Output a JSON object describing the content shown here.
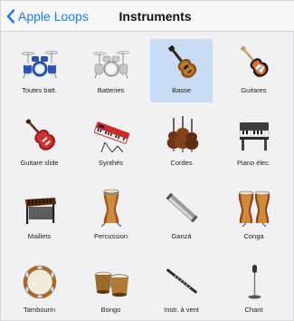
{
  "navbar": {
    "back_label": "Apple Loops",
    "title": "Instruments"
  },
  "instruments": [
    {
      "label": "Toutes batt.",
      "icon": "drum-kit-blue-icon",
      "selected": false
    },
    {
      "label": "Batteries",
      "icon": "drum-kit-silver-icon",
      "selected": false
    },
    {
      "label": "Basse",
      "icon": "bass-guitar-icon",
      "selected": true
    },
    {
      "label": "Guitares",
      "icon": "electric-guitar-icon",
      "selected": false
    },
    {
      "label": "Guitare slide",
      "icon": "red-guitar-icon",
      "selected": false
    },
    {
      "label": "Synthés",
      "icon": "synth-keyboard-icon",
      "selected": false
    },
    {
      "label": "Cordes",
      "icon": "cello-icon",
      "selected": false
    },
    {
      "label": "Piano élec.",
      "icon": "electric-piano-icon",
      "selected": false
    },
    {
      "label": "Maillets",
      "icon": "marimba-icon",
      "selected": false
    },
    {
      "label": "Percussion",
      "icon": "conga-icon",
      "selected": false
    },
    {
      "label": "Ganzá",
      "icon": "shaker-icon",
      "selected": false
    },
    {
      "label": "Conga",
      "icon": "conga-pair-icon",
      "selected": false
    },
    {
      "label": "Tambourin",
      "icon": "tambourine-icon",
      "selected": false
    },
    {
      "label": "Bongo",
      "icon": "bongo-icon",
      "selected": false
    },
    {
      "label": "Instr. à vent",
      "icon": "flute-icon",
      "selected": false
    },
    {
      "label": "Chant",
      "icon": "microphone-icon",
      "selected": false
    }
  ],
  "colors": {
    "accent": "#1a7cf5",
    "selected_tile": "#c9dcf5"
  }
}
